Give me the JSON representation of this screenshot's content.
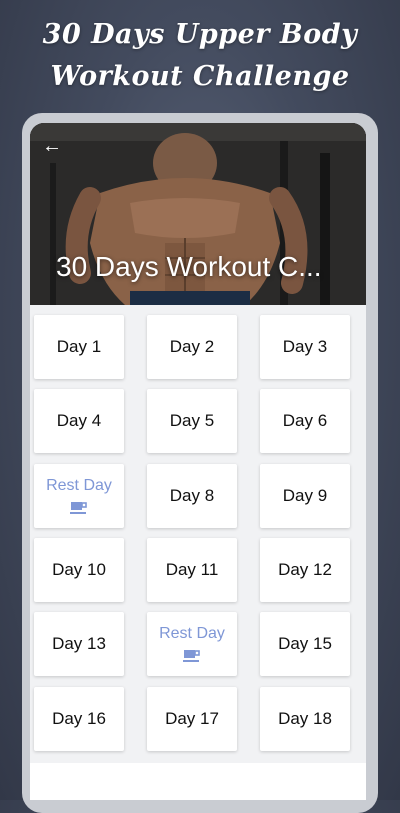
{
  "promo": {
    "title_line1": "30 Days Upper Body",
    "title_line2": "Workout Challenge"
  },
  "hero": {
    "title": "30 Days Workout C...",
    "back_icon": "arrow-left-icon"
  },
  "days": [
    {
      "label": "Day 1",
      "rest": false
    },
    {
      "label": "Day 2",
      "rest": false
    },
    {
      "label": "Day 3",
      "rest": false
    },
    {
      "label": "Day 4",
      "rest": false
    },
    {
      "label": "Day 5",
      "rest": false
    },
    {
      "label": "Day 6",
      "rest": false
    },
    {
      "label": "Rest Day",
      "rest": true
    },
    {
      "label": "Day 8",
      "rest": false
    },
    {
      "label": "Day 9",
      "rest": false
    },
    {
      "label": "Day 10",
      "rest": false
    },
    {
      "label": "Day 11",
      "rest": false
    },
    {
      "label": "Day 12",
      "rest": false
    },
    {
      "label": "Day 13",
      "rest": false
    },
    {
      "label": "Rest Day",
      "rest": true
    },
    {
      "label": "Day 15",
      "rest": false
    },
    {
      "label": "Day 16",
      "rest": false
    },
    {
      "label": "Day 17",
      "rest": false
    },
    {
      "label": "Day 18",
      "rest": false
    }
  ],
  "colors": {
    "rest_accent": "#7f97d6",
    "background": "#434b5e"
  }
}
